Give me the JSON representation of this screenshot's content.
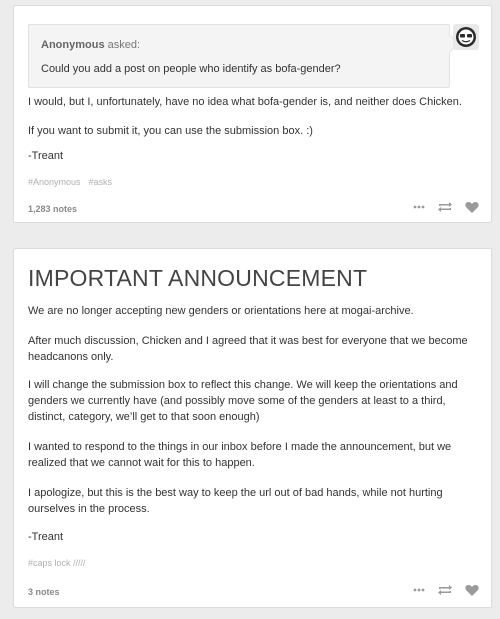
{
  "post1": {
    "asker_name": "Anonymous",
    "asked_word": "asked:",
    "question": "Could you add a post on people who identify as bofa-gender?",
    "paragraphs": [
      "I would, but I, unfortunately, have no idea what bofa-gender is, and neither does Chicken.",
      "If you want to submit it, you can use the submission box. :)",
      "-Treant"
    ],
    "tags": [
      "#Anonymous",
      "#asks"
    ],
    "notes": "1,283 notes"
  },
  "post2": {
    "title": "IMPORTANT ANNOUNCEMENT",
    "paragraphs": [
      "We are no longer accepting new genders or orientations here at mogai-archive.",
      "After much discussion, Chicken and I agreed that it was best for everyone that we become headcanons only.",
      "I will change the submission box to reflect this change. We will keep the orientations and genders we currently have (and possibly move some of the genders at least to a third, distinct, category, we’ll get to that soon enough)",
      "I wanted to respond to the things in our inbox before I made the announcement, but we realized that we cannot wait for this to happen.",
      "I apologize, but this is the best way to keep the url out of bad hands, while not hurting ourselves in the process.",
      "-Treant"
    ],
    "tags": [
      "#caps lock /////"
    ],
    "notes": "3 notes"
  },
  "icons": {
    "more": "more-dots-icon",
    "reblog": "reblog-icon",
    "like": "heart-icon",
    "avatar": "asker-avatar"
  },
  "colors": {
    "background": "#ececec",
    "card": "#ffffff",
    "icon": "#9a9a9a"
  }
}
